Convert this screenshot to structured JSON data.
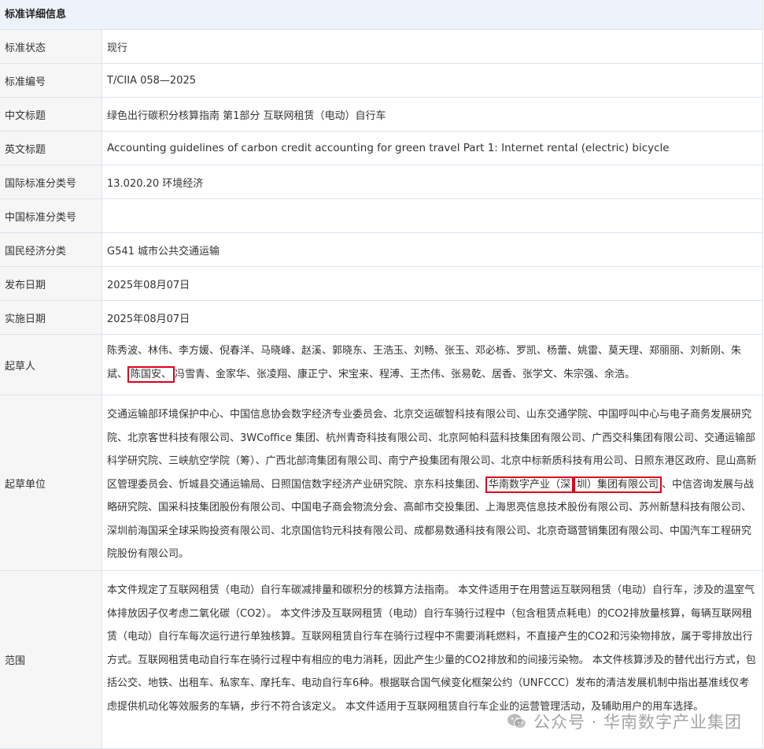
{
  "header": {
    "title": "标准详细信息"
  },
  "rows": {
    "status": {
      "label": "标准状态",
      "value": "现行"
    },
    "number": {
      "label": "标准编号",
      "value": "T/CIIA 058—2025"
    },
    "title_cn": {
      "label": "中文标题",
      "value": "绿色出行碳积分核算指南 第1部分 互联网租赁（电动）自行车"
    },
    "title_en": {
      "label": "英文标题",
      "value": "Accounting guidelines of carbon credit accounting for green travel Part 1: Internet rental (electric) bicycle"
    },
    "ics": {
      "label": "国际标准分类号",
      "value": "13.020.20 环境经济"
    },
    "ccs": {
      "label": "中国标准分类号",
      "value": ""
    },
    "econ": {
      "label": "国民经济分类",
      "value": "G541 城市公共交通运输"
    },
    "release": {
      "label": "发布日期",
      "value": "2025年08月07日"
    },
    "implement": {
      "label": "实施日期",
      "value": "2025年08月07日"
    },
    "drafters": {
      "label": "起草人",
      "before": "陈秀波、林伟、李方媛、倪春洋、马晓峰、赵溪、郭晓东、王浩玉、刘畅、张玉、邓必栋、罗凯、杨蕾、姚雷、莫天理、郑丽丽、刘新刚、朱斌、",
      "highlight": "陈国安、",
      "after": "冯雪青、金家华、张凌翔、康正宁、宋宝来、程溥、王杰伟、张易乾、居香、张学文、朱宗强、余浩。"
    },
    "units": {
      "label": "起草单位",
      "before": "交通运输部环境保护中心、中国信息协会数字经济专业委员会、北京交运碳智科技有限公司、山东交通学院、中国呼叫中心与电子商务发展研究院、北京客世科技有限公司、3WCoffice 集团、杭州青奇科技有限公司、北京阿帕科蓝科技集团有限公司、广西交科集团有限公司、交通运输部科学研究院、三峡航空学院（筹）、广西北部湾集团有限公司、南宁产投集团有限公司、北京中标新质科技有用公司、日照东港区政府、昆山高新区管理委员会、忻城县交通运输局、日照国信数字经济产业研究院、京东科技集团、",
      "hl1": "华南数字产业（深",
      "hl2": "圳）集团有限公司",
      "after": "、中信咨询发展与战略研究院、国采科技集团股份有限公司、中国电子商会物流分会、高邮市交投集团、上海思亮信息技术股份有限公司、苏州新慧科技有限公司、深圳前海国采全球采购投资有限公司、北京国信钧元科技有限公司、成都易数通科技有限公司、北京奇璐营销集团有限公司、中国汽车工程研究院股份有限公司。"
    },
    "scope": {
      "label": "范围",
      "value": "本文件规定了互联网租赁（电动）自行车碳减排量和碳积分的核算方法指南。 本文件适用于在用营运互联网租赁（电动）自行车，涉及的温室气体排放因子仅考虑二氧化碳（CO2）。 本文件涉及互联网租赁（电动）自行车骑行过程中（包含租赁点耗电）的CO2排放量核算，每辆互联网租赁（电动）自行车每次运行进行单独核算。互联网租赁自行车在骑行过程中不需要消耗燃料，不直接产生的CO2和污染物排放，属于零排放出行方式。互联网租赁电动自行车在骑行过程中有相应的电力消耗，因此产生少量的CO2排放和的间接污染物。 本文件核算涉及的替代出行方式，包括公交、地铁、出租车、私家车、摩托车、电动自行车6种。根据联合国气候变化框架公约（UNFCCC）发布的清洁发展机制中指出基准线仅考虑提供机动化等效服务的车辆，步行不符合该定义。 本文件适用于互联网租赁自行车企业的运营管理活动，及辅助用户的用车选择。"
    }
  },
  "watermark": {
    "text": "公众号 · 华南数字产业集团",
    "icon": "wechat-icon"
  }
}
